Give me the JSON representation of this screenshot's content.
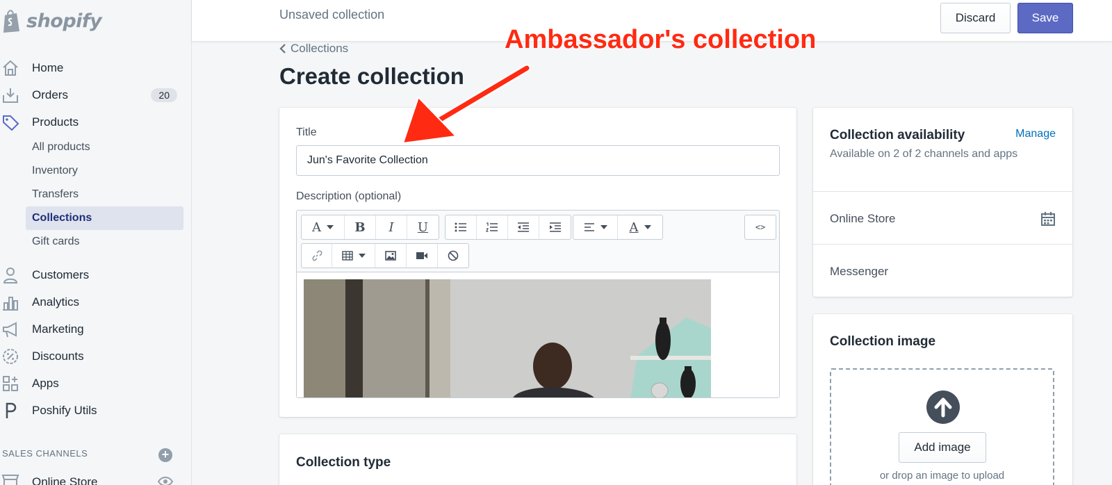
{
  "brand": {
    "name": "shopify"
  },
  "topbar": {
    "title": "Unsaved collection",
    "discard_label": "Discard",
    "save_label": "Save"
  },
  "sidebar": {
    "items": [
      {
        "label": "Home",
        "icon": "home-icon"
      },
      {
        "label": "Orders",
        "icon": "orders-icon",
        "badge": "20"
      },
      {
        "label": "Products",
        "icon": "tag-icon"
      },
      {
        "label": "Customers",
        "icon": "customers-icon"
      },
      {
        "label": "Analytics",
        "icon": "analytics-icon"
      },
      {
        "label": "Marketing",
        "icon": "megaphone-icon"
      },
      {
        "label": "Discounts",
        "icon": "discount-icon"
      },
      {
        "label": "Apps",
        "icon": "apps-icon"
      },
      {
        "label": "Poshify Utils",
        "icon": "poshify-icon"
      }
    ],
    "product_subitems": [
      "All products",
      "Inventory",
      "Transfers",
      "Collections",
      "Gift cards"
    ],
    "active_subitem": "Collections",
    "sales_channels": {
      "heading": "SALES CHANNELS",
      "items": [
        {
          "label": "Online Store"
        }
      ]
    }
  },
  "breadcrumb": {
    "label": "Collections"
  },
  "page": {
    "title": "Create collection"
  },
  "form": {
    "title_label": "Title",
    "title_value": "Jun's Favorite Collection",
    "description_label": "Description (optional)",
    "toolbar": {
      "row1": [
        "font-icon",
        "bold-icon",
        "italic-icon",
        "underline-icon",
        "bulleted-list-icon",
        "numbered-list-icon",
        "outdent-icon",
        "indent-icon",
        "align-icon",
        "text-color-icon",
        "html-icon"
      ],
      "row2": [
        "link-icon",
        "table-icon",
        "image-icon",
        "video-icon",
        "clear-format-icon"
      ],
      "font_glyph": "A",
      "bold_glyph": "B",
      "italic_glyph": "I",
      "underline_glyph": "U",
      "color_glyph": "A",
      "html_glyph": "<>"
    }
  },
  "collection_type": {
    "heading": "Collection type"
  },
  "availability": {
    "heading": "Collection availability",
    "manage_label": "Manage",
    "subtitle": "Available on 2 of 2 channels and apps",
    "channels": [
      "Online Store",
      "Messenger"
    ]
  },
  "collection_image": {
    "heading": "Collection image",
    "add_label": "Add image",
    "hint": "or drop an image to upload"
  },
  "annotation": {
    "text": "Ambassador's collection",
    "color": "#ff2a12"
  },
  "colors": {
    "primary": "#5c6ac4",
    "link": "#006fbb",
    "active_nav": "#202e78"
  }
}
